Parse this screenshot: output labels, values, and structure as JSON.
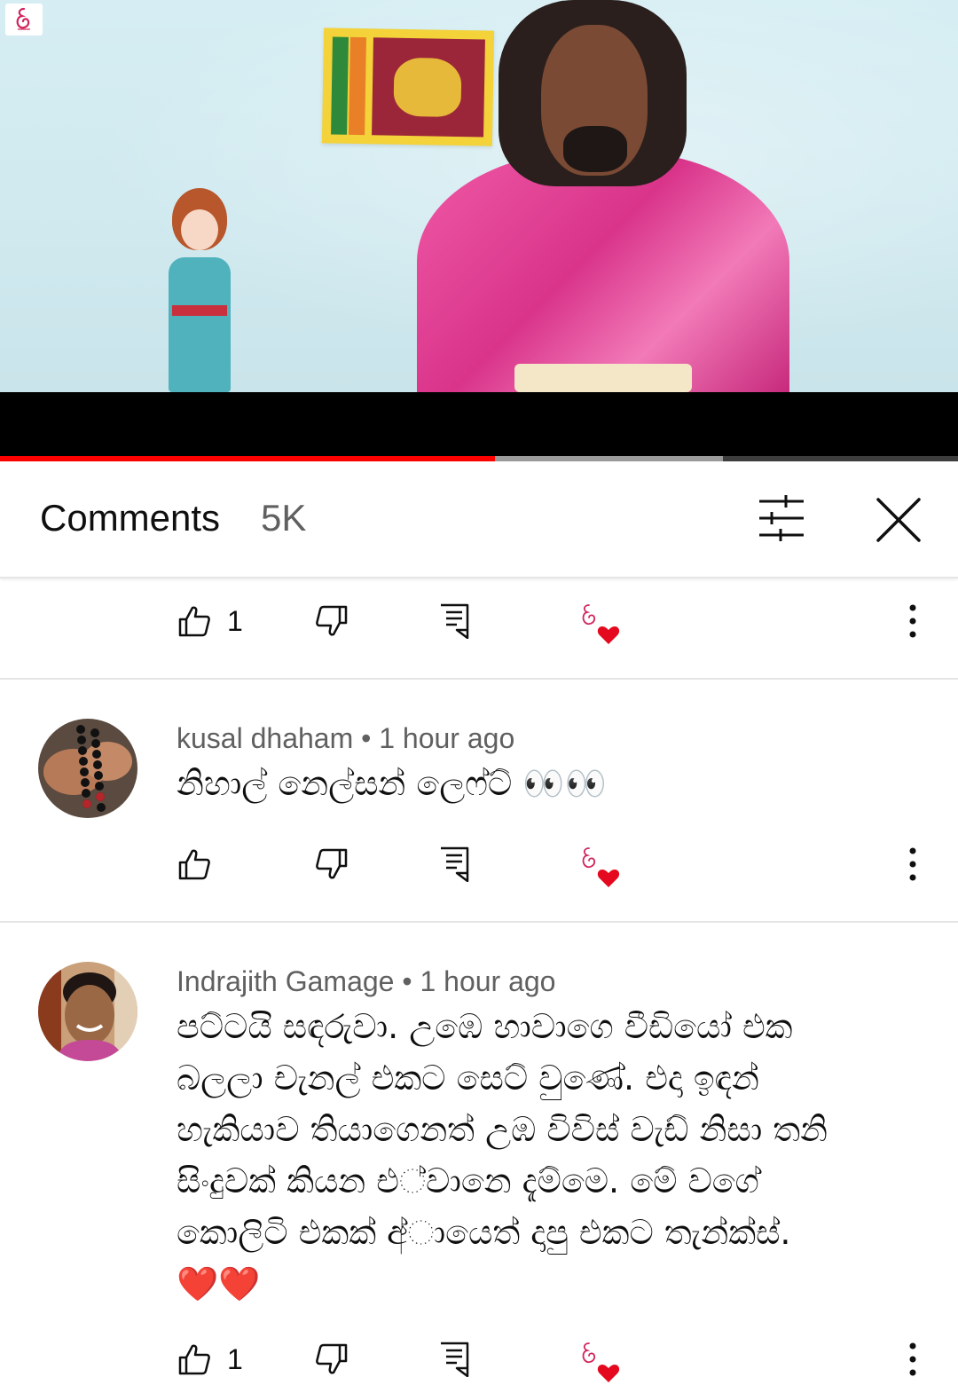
{
  "header": {
    "title": "Comments",
    "count": "5K"
  },
  "video": {
    "progress_played": 0.517,
    "progress_buffered": 0.755
  },
  "comments": [
    {
      "likes": "1"
    },
    {
      "author": "kusal dhaham",
      "separator": "•",
      "time": "1 hour ago",
      "text": "නිහාල් නෙල්සන් ලෙෆ්ට් 👀👀",
      "likes": ""
    },
    {
      "author": "Indrajith Gamage",
      "separator": "•",
      "time": "1 hour ago",
      "text_lines": [
        "පට්ටයි සඳරුවා. උඹෙ හාවාගෙ වීඩියෝ එක",
        "බලලා චැනල් එකට සෙට් වුණේ. එදා ඉඳන්",
        "හැකියාව තියාගෙනත් උඹ විවිස් වැඩ් නිසා තනි",
        "සිංදුවක් කියන එ්වානෙ දැම්මෙ. මේ වගේ",
        "කොලිටි එකක් අ්ායෙත් දාපු එකට තැන්ක්ස්.",
        "❤️❤️"
      ],
      "likes": "1"
    }
  ],
  "icons": {
    "like": "thumb-up-icon",
    "dislike": "thumb-down-icon",
    "reply": "reply-icon",
    "creator_heart": "creator-heart-icon",
    "more": "more-vert-icon",
    "filter": "filter-icon",
    "close": "close-icon"
  },
  "colors": {
    "accent_red": "#ff0000",
    "heart": "#e5091f",
    "text_primary": "#0f0f0f",
    "text_secondary": "#606060"
  }
}
